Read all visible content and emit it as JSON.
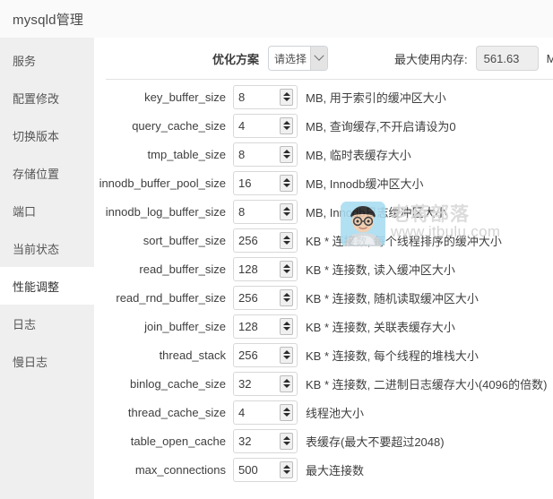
{
  "window": {
    "title": "mysqld管理"
  },
  "sidebar": {
    "items": [
      {
        "label": "服务",
        "name": "service",
        "active": false
      },
      {
        "label": "配置修改",
        "name": "config-edit",
        "active": false
      },
      {
        "label": "切换版本",
        "name": "switch-version",
        "active": false
      },
      {
        "label": "存储位置",
        "name": "storage-path",
        "active": false
      },
      {
        "label": "端口",
        "name": "port",
        "active": false
      },
      {
        "label": "当前状态",
        "name": "current-status",
        "active": false
      },
      {
        "label": "性能调整",
        "name": "performance-tuning",
        "active": true
      },
      {
        "label": "日志",
        "name": "log",
        "active": false
      },
      {
        "label": "慢日志",
        "name": "slow-log",
        "active": false
      }
    ]
  },
  "toolbar": {
    "plan_label": "优化方案",
    "plan_value": "请选择",
    "plan_options": [
      "请选择"
    ],
    "memory_label": "最大使用内存:",
    "memory_value": "561.63",
    "memory_unit": "MB"
  },
  "params": [
    {
      "name": "key_buffer_size",
      "value": "8",
      "desc": "MB, 用于索引的缓冲区大小"
    },
    {
      "name": "query_cache_size",
      "value": "4",
      "desc": "MB, 查询缓存,不开启请设为0"
    },
    {
      "name": "tmp_table_size",
      "value": "8",
      "desc": "MB, 临时表缓存大小"
    },
    {
      "name": "innodb_buffer_pool_size",
      "value": "16",
      "desc": "MB, Innodb缓冲区大小"
    },
    {
      "name": "innodb_log_buffer_size",
      "value": "8",
      "desc": "MB, Innodb日志缓冲区大小"
    },
    {
      "name": "sort_buffer_size",
      "value": "256",
      "desc": "KB * 连接数, 每个线程排序的缓冲大小"
    },
    {
      "name": "read_buffer_size",
      "value": "128",
      "desc": "KB * 连接数, 读入缓冲区大小"
    },
    {
      "name": "read_rnd_buffer_size",
      "value": "256",
      "desc": "KB * 连接数, 随机读取缓冲区大小"
    },
    {
      "name": "join_buffer_size",
      "value": "128",
      "desc": "KB * 连接数, 关联表缓存大小"
    },
    {
      "name": "thread_stack",
      "value": "256",
      "desc": "KB * 连接数, 每个线程的堆栈大小"
    },
    {
      "name": "binlog_cache_size",
      "value": "32",
      "desc": "KB * 连接数, 二进制日志缓存大小(4096的倍数)"
    },
    {
      "name": "thread_cache_size",
      "value": "4",
      "desc": "线程池大小"
    },
    {
      "name": "table_open_cache",
      "value": "32",
      "desc": "表缓存(最大不要超过2048)"
    },
    {
      "name": "max_connections",
      "value": "500",
      "desc": "最大连接数"
    }
  ],
  "watermark": {
    "brand": "老蒋部落",
    "url": "www.itbulu.com"
  },
  "colors": {
    "sidebar_bg": "#efefef",
    "titlebar_bg": "#fafafa",
    "content_bg": "#ffffff",
    "text": "#3f3f3f",
    "input_border": "#d8d8d8",
    "disabled_field": "#eeeeee"
  }
}
